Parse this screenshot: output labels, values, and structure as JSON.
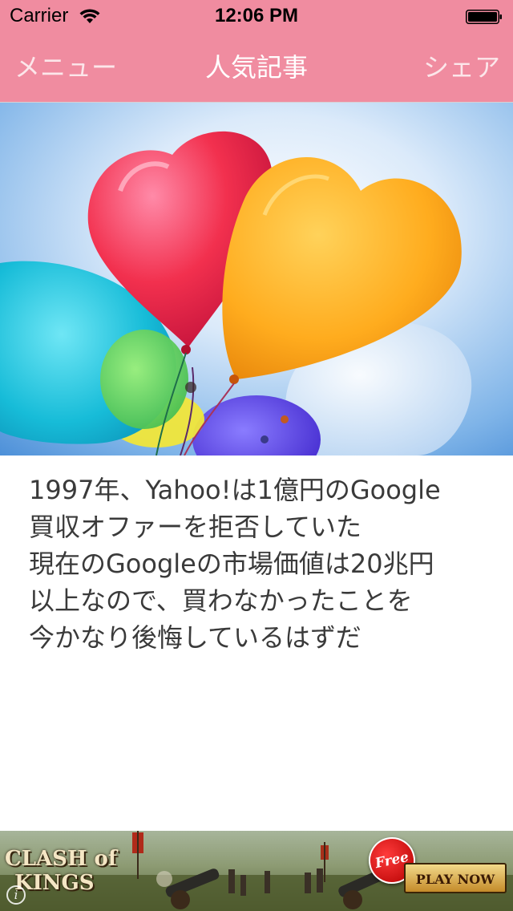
{
  "status_bar": {
    "carrier": "Carrier",
    "time": "12:06 PM",
    "wifi_icon": "wifi-icon",
    "battery_icon": "battery-icon"
  },
  "nav": {
    "left_label": "メニュー",
    "title": "人気記事",
    "right_label": "シェア",
    "background_color": "#f08ca0"
  },
  "hero": {
    "image": "heart-shaped balloons against a blue sky"
  },
  "article": {
    "lines": [
      "1997年、Yahoo!は1億円のGoogle",
      "買収オファーを拒否していた",
      "現在のGoogleの市場価値は20兆円",
      "以上なので、買わなかったことを",
      "今かなり後悔しているはずだ"
    ]
  },
  "ad": {
    "logo_line1": "CLASH of",
    "logo_line2": "KINGS",
    "free_badge": "Free",
    "cta": "PLAY NOW",
    "info_icon": "info-icon"
  }
}
